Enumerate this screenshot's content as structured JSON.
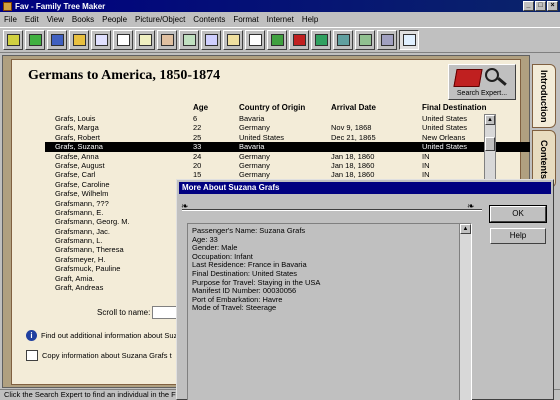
{
  "window": {
    "title": "Fav - Family Tree Maker",
    "controls": [
      "_",
      "□",
      "×"
    ]
  },
  "menu": [
    "File",
    "Edit",
    "View",
    "Books",
    "People",
    "Picture/Object",
    "Contents",
    "Format",
    "Internet",
    "Help"
  ],
  "toolbar": {
    "buttons": [
      {
        "name": "open-icon",
        "color": "#d0d040"
      },
      {
        "name": "back-icon",
        "color": "#40b040"
      },
      {
        "name": "family-page-icon",
        "color": "#4060c0"
      },
      {
        "name": "individual-icon",
        "color": "#e8c040"
      },
      {
        "name": "pedigree-icon",
        "color": "#e0e0ff"
      },
      {
        "name": "descendant-icon",
        "color": "#ffffff"
      },
      {
        "name": "outline-icon",
        "color": "#f0f0c0"
      },
      {
        "name": "genealogy-report-icon",
        "color": "#e0c0a0"
      },
      {
        "name": "family-group-icon",
        "color": "#c0e0c0"
      },
      {
        "name": "kinship-icon",
        "color": "#d0d0ff"
      },
      {
        "name": "calendar-icon",
        "color": "#f0e0a0"
      },
      {
        "name": "report-icon",
        "color": "#ffffff"
      },
      {
        "name": "map-icon",
        "color": "#40a040"
      },
      {
        "name": "book-icon",
        "color": "#c02020"
      },
      {
        "name": "puzzle-icon",
        "color": "#30a060"
      },
      {
        "name": "database-icon",
        "color": "#60a0a0"
      },
      {
        "name": "scrapbook-icon",
        "color": "#90c090"
      },
      {
        "name": "computer-icon",
        "color": "#a0a0c0"
      },
      {
        "name": "search-icon",
        "color": "#e0f0ff"
      }
    ]
  },
  "page": {
    "title": "Germans to America, 1850-1874",
    "search_expert_label": "Search Expert...",
    "tabs": [
      "Introduction",
      "Contents"
    ],
    "columns": [
      "Age",
      "Country of Origin",
      "Arrival Date",
      "Final Destination"
    ],
    "rows": [
      [
        "Grafs, Louis",
        "6",
        "Bavaria",
        "",
        "United States"
      ],
      [
        "Grafs, Marga",
        "22",
        "Germany",
        "Nov 9, 1868",
        "United States"
      ],
      [
        "Grafs, Robert",
        "25",
        "United States",
        "Dec 21, 1865",
        "New Orleans"
      ],
      [
        "Grafs, Suzana",
        "33",
        "Bavaria",
        "",
        "United States"
      ],
      [
        "Grafse, Anna",
        "24",
        "Germany",
        "Jan 18, 1860",
        "IN"
      ],
      [
        "Grafse, August",
        "20",
        "Germany",
        "Jan 18, 1860",
        "IN"
      ],
      [
        "Grafse, Carl",
        "15",
        "Germany",
        "Jan 18, 1860",
        "IN"
      ],
      [
        "Grafse, Caroline",
        "",
        "",
        "",
        ""
      ],
      [
        "Grafse, Wilhelm",
        "",
        "",
        "",
        ""
      ],
      [
        "Grafsmann, ???",
        "",
        "",
        "",
        ""
      ],
      [
        "Grafsmann, E.",
        "",
        "",
        "",
        ""
      ],
      [
        "Grafsmann, Georg. M.",
        "",
        "",
        "",
        ""
      ],
      [
        "Grafsmann, Jac.",
        "",
        "",
        "",
        ""
      ],
      [
        "Grafsmann, L.",
        "",
        "",
        "",
        ""
      ],
      [
        "Grafsmann, Theresa",
        "",
        "",
        "",
        ""
      ],
      [
        "Grafsmeyer, H.",
        "",
        "",
        "",
        ""
      ],
      [
        "Grafsmuck, Pauline",
        "",
        "",
        "",
        ""
      ],
      [
        "Graft, Amia.",
        "",
        "",
        "",
        ""
      ],
      [
        "Graft, Andreas",
        "",
        "",
        "",
        ""
      ]
    ],
    "selected_index": 3,
    "scroll_label": "Scroll to name:",
    "info_text": "Find out additional information about Suz",
    "copy_text": "Copy information about Suzana Grafs t"
  },
  "status": "Click the Search Expert to find an individual in the F",
  "dialog": {
    "title": "More About Suzana Grafs",
    "ok": "OK",
    "help": "Help",
    "lines": [
      "Passenger's Name: Suzana Grafs",
      "Age: 33",
      "Gender: Male",
      "Occupation: Infant",
      "Last Residence: France in Bavaria",
      "Final Destination: United States",
      "Purpose for Travel: Staying in the USA",
      "Manifest ID Number: 00030056",
      "Port of Embarkation: Havre",
      "Mode of Travel: Steerage"
    ]
  }
}
